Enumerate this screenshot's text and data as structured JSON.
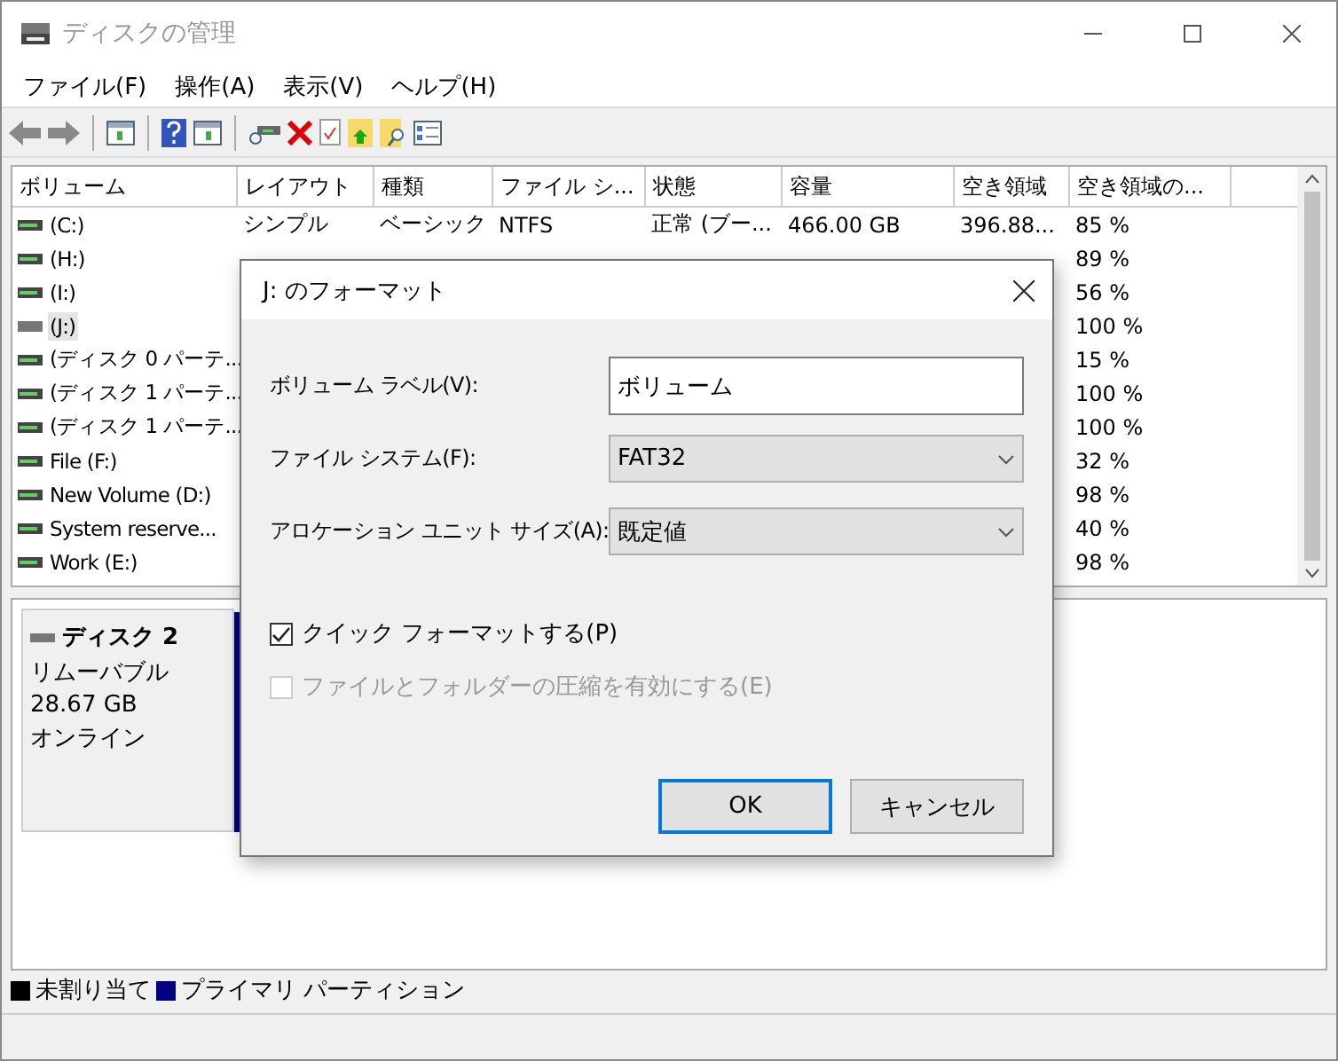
{
  "window": {
    "title": "ディスクの管理"
  },
  "menu": [
    "ファイル(F)",
    "操作(A)",
    "表示(V)",
    "ヘルプ(H)"
  ],
  "table": {
    "columns": [
      "ボリューム",
      "レイアウト",
      "種類",
      "ファイル シ...",
      "状態",
      "容量",
      "空き領域",
      "空き領域の..."
    ],
    "rows": [
      {
        "cells": [
          "(C:)",
          "シンプル",
          "ベーシック",
          "NTFS",
          "正常 (ブー...",
          "466.00 GB",
          "396.88...",
          "85 %"
        ],
        "selected": false
      },
      {
        "cells": [
          "(H:)",
          null,
          null,
          null,
          null,
          null,
          null,
          "89 %"
        ],
        "selected": false
      },
      {
        "cells": [
          "(I:)",
          null,
          null,
          null,
          null,
          null,
          null,
          "56 %"
        ],
        "selected": false
      },
      {
        "cells": [
          "(J:)",
          null,
          null,
          null,
          null,
          null,
          null,
          "100 %"
        ],
        "selected": true
      },
      {
        "cells": [
          "(ディスク 0 パーテ...",
          null,
          null,
          null,
          null,
          null,
          null,
          "15 %"
        ],
        "selected": false
      },
      {
        "cells": [
          "(ディスク 1 パーテ...",
          null,
          null,
          null,
          null,
          null,
          null,
          "100 %"
        ],
        "selected": false
      },
      {
        "cells": [
          "(ディスク 1 パーテ...",
          null,
          null,
          null,
          null,
          null,
          null,
          "100 %"
        ],
        "selected": false
      },
      {
        "cells": [
          "File (F:)",
          null,
          null,
          null,
          null,
          null,
          null,
          "32 %"
        ],
        "selected": false
      },
      {
        "cells": [
          "New Volume (D:)",
          null,
          null,
          null,
          null,
          null,
          null,
          "98 %"
        ],
        "selected": false
      },
      {
        "cells": [
          "System reserve...",
          null,
          null,
          null,
          null,
          null,
          null,
          "40 %"
        ],
        "selected": false
      },
      {
        "cells": [
          "Work (E:)",
          null,
          null,
          null,
          null,
          null,
          null,
          "98 %"
        ],
        "selected": false
      }
    ]
  },
  "disk": {
    "name": "ディスク 2",
    "type": "リムーバブル",
    "size": "28.67 GB",
    "status": "オンライン"
  },
  "legend": [
    {
      "label": "未割り当て",
      "color": "#000000"
    },
    {
      "label": "プライマリ パーティション",
      "color": "#000080"
    }
  ],
  "dialog": {
    "title": "J: のフォーマット",
    "fields": [
      {
        "kind": "text",
        "label": "ボリューム ラベル(V):",
        "value": "ボリューム"
      },
      {
        "kind": "select",
        "label": "ファイル システム(F):",
        "value": "FAT32"
      },
      {
        "kind": "select",
        "label": "アロケーション ユニット サイズ(A):",
        "value": "既定値"
      }
    ],
    "checks": [
      {
        "label": "クイック フォーマットする(P)",
        "checked": true,
        "disabled": false
      },
      {
        "label": "ファイルとフォルダーの圧縮を有効にする(E)",
        "checked": false,
        "disabled": true
      }
    ],
    "buttons": [
      {
        "label": "OK",
        "default": true
      },
      {
        "label": "キャンセル",
        "default": false
      }
    ]
  }
}
